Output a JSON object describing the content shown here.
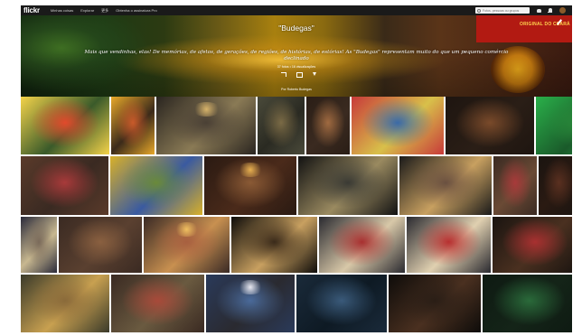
{
  "topbar": {
    "logo": "flickr",
    "nav": [
      "Minhas coisas",
      "Explorar",
      "更多",
      "Obtenha o assinatura Pro"
    ],
    "search_placeholder": "Fotos, pessoas ou grupos"
  },
  "album": {
    "title": "\"Budegas\"",
    "description": "Mais que vendinhas, elas! De memórias, de afetos, de gerações, de regiões, de histórias, de estórias! As \"Budegas\" representam muito do que um pequeno comércio declinado",
    "stats": "37 fotos • 16 visualizações",
    "owner": "Por Roberto Budegas",
    "sign_text": "ORIGINAL DO CEARÁ"
  },
  "photos": {
    "row1": [
      {
        "name": "photo-pink-storefront",
        "colors": [
          "#f4d34a",
          "#e24a2c",
          "#3a5a2a"
        ],
        "lamp": null
      },
      {
        "name": "photo-yellow-counter",
        "colors": [
          "#e8a82a",
          "#c95a2a",
          "#3b2a1a"
        ],
        "lamp": null
      },
      {
        "name": "photo-dark-shop-interior",
        "colors": [
          "#2a2520",
          "#4a4035",
          "#8a7a55"
        ],
        "lamp": "#d7b36a"
      },
      {
        "name": "photo-shelves-bottles",
        "colors": [
          "#4a4a3a",
          "#7a6a45",
          "#2a2a22"
        ],
        "lamp": null
      },
      {
        "name": "photo-smiling-man-portrait",
        "colors": [
          "#2a1e16",
          "#a06a40",
          "#3a2a20"
        ],
        "lamp": null
      },
      {
        "name": "photo-colorful-snack-shelves",
        "colors": [
          "#c83a3a",
          "#3a6aa8",
          "#d8c04a"
        ],
        "lamp": null
      },
      {
        "name": "photo-woman-dark-portrait",
        "colors": [
          "#1e1510",
          "#7a4a2a",
          "#2a1e16"
        ],
        "lamp": null
      },
      {
        "name": "photo-man-green-wall",
        "colors": [
          "#2ab04a",
          "#2a8a3a",
          "#1a5a2a"
        ],
        "lamp": null
      }
    ],
    "row2": [
      {
        "name": "photo-woman-counter-red",
        "colors": [
          "#5a3a2a",
          "#a83a3a",
          "#3a2a22"
        ],
        "lamp": null
      },
      {
        "name": "photo-bananas-vendor",
        "colors": [
          "#d8b02a",
          "#6a8a3a",
          "#3a5aa0"
        ],
        "lamp": null
      },
      {
        "name": "photo-shirtless-man-shop",
        "colors": [
          "#2a1a12",
          "#8a5a35",
          "#4a2a1a"
        ],
        "lamp": "#e8b050"
      },
      {
        "name": "photo-night-storefront-window",
        "colors": [
          "#121212",
          "#3a3a34",
          "#9a8a60"
        ],
        "lamp": null
      },
      {
        "name": "photo-corner-shop-night",
        "colors": [
          "#1a1a1a",
          "#6a5040",
          "#c8a060"
        ],
        "lamp": null
      },
      {
        "name": "photo-man-red-shirt",
        "colors": [
          "#3a2a22",
          "#a83a3a",
          "#6a4a35"
        ],
        "lamp": null
      },
      {
        "name": "photo-bottles-counter-dark",
        "colors": [
          "#1a1410",
          "#5a3020",
          "#2a1a12"
        ],
        "lamp": null
      }
    ],
    "row3": [
      {
        "name": "photo-street-stall-lights",
        "colors": [
          "#2a2a3a",
          "#7a6a5a",
          "#c8b890"
        ],
        "lamp": null
      },
      {
        "name": "photo-market-stalls",
        "colors": [
          "#3a2a22",
          "#8a6040",
          "#5a4030"
        ],
        "lamp": null
      },
      {
        "name": "photo-bar-interior-people",
        "colors": [
          "#3a2a25",
          "#a86040",
          "#c89050"
        ],
        "lamp": "#f0c060"
      },
      {
        "name": "photo-dancer-raised-arm",
        "colors": [
          "#0e0c0a",
          "#3a2a1a",
          "#c8a060"
        ],
        "lamp": null
      },
      {
        "name": "photo-people-red-shirts-bar",
        "colors": [
          "#2a2a30",
          "#a83030",
          "#d8c8a8"
        ],
        "lamp": null
      },
      {
        "name": "photo-group-red-shirts",
        "colors": [
          "#2a2a30",
          "#b83030",
          "#e0d0b0"
        ],
        "lamp": null
      },
      {
        "name": "photo-crowd-red-night",
        "colors": [
          "#1a1410",
          "#a83030",
          "#4a3020"
        ],
        "lamp": null
      }
    ],
    "row4": [
      {
        "name": "photo-market-goods-stall",
        "colors": [
          "#3a3a2a",
          "#8a6a3a",
          "#c8a050"
        ],
        "lamp": null
      },
      {
        "name": "photo-woman-table-food",
        "colors": [
          "#3a2a22",
          "#a84a3a",
          "#6a5a40"
        ],
        "lamp": null
      },
      {
        "name": "photo-blue-shop-people",
        "colors": [
          "#2a3a5a",
          "#4a6a9a",
          "#2a2a30"
        ],
        "lamp": "#e8e8f0"
      },
      {
        "name": "photo-blue-lit-man",
        "colors": [
          "#1a2a3a",
          "#3a5a7a",
          "#0e1a24"
        ],
        "lamp": null
      },
      {
        "name": "photo-shirtless-man-dark-shop",
        "colors": [
          "#0e0c0a",
          "#2a1e16",
          "#4a3020"
        ],
        "lamp": null
      },
      {
        "name": "photo-green-lit-shop-night",
        "colors": [
          "#0e1a12",
          "#2a6a3a",
          "#142418"
        ],
        "lamp": null
      }
    ]
  }
}
